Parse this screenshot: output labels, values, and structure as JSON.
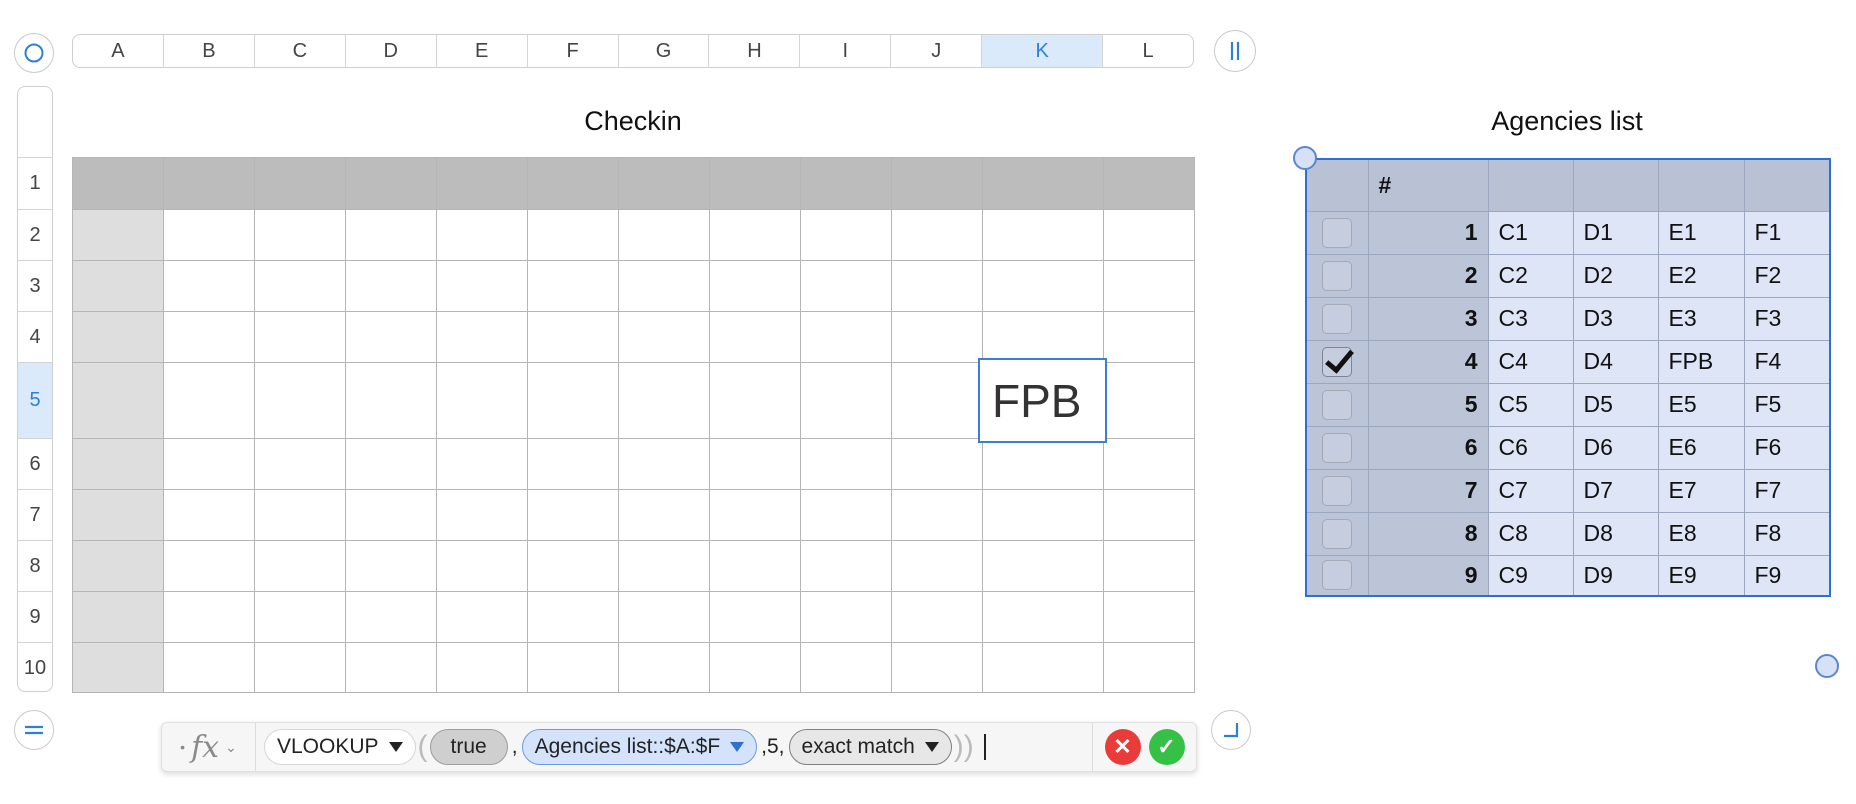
{
  "sheet": {
    "columns": [
      "A",
      "B",
      "C",
      "D",
      "E",
      "F",
      "G",
      "H",
      "I",
      "J",
      "K",
      "L"
    ],
    "selected_column": "K",
    "rows": [
      "1",
      "2",
      "3",
      "4",
      "5",
      "6",
      "7",
      "8",
      "9",
      "10"
    ],
    "selected_row": "5"
  },
  "checkin_table": {
    "title": "Checkin",
    "selected_cell_value": "FPB"
  },
  "agencies_table": {
    "title": "Agencies list",
    "header": [
      "",
      "#",
      "",
      "",
      "",
      ""
    ],
    "rows": [
      {
        "checked": false,
        "num": "1",
        "c": "C1",
        "d": "D1",
        "e": "E1",
        "f": "F1"
      },
      {
        "checked": false,
        "num": "2",
        "c": "C2",
        "d": "D2",
        "e": "E2",
        "f": "F2"
      },
      {
        "checked": false,
        "num": "3",
        "c": "C3",
        "d": "D3",
        "e": "E3",
        "f": "F3"
      },
      {
        "checked": true,
        "num": "4",
        "c": "C4",
        "d": "D4",
        "e": "FPB",
        "f": "F4"
      },
      {
        "checked": false,
        "num": "5",
        "c": "C5",
        "d": "D5",
        "e": "E5",
        "f": "F5"
      },
      {
        "checked": false,
        "num": "6",
        "c": "C6",
        "d": "D6",
        "e": "E6",
        "f": "F6"
      },
      {
        "checked": false,
        "num": "7",
        "c": "C7",
        "d": "D7",
        "e": "E7",
        "f": "F7"
      },
      {
        "checked": false,
        "num": "8",
        "c": "C8",
        "d": "D8",
        "e": "E8",
        "f": "F8"
      },
      {
        "checked": false,
        "num": "9",
        "c": "C9",
        "d": "D9",
        "e": "E9",
        "f": "F9"
      }
    ]
  },
  "formula_bar": {
    "dot": "•",
    "fx_label": "fx",
    "chevron": "⌄",
    "function_name": "VLOOKUP",
    "arg1": "true",
    "separator1": ",",
    "arg2": "Agencies list::$A:$F",
    "separator2_arg3": ",5,",
    "arg4": "exact match",
    "cancel_glyph": "✕",
    "accept_glyph": "✓"
  },
  "colors": {
    "accent": "#2f7fd8",
    "selection_fill": "#dbeafb",
    "agencies_border": "#2f6fd1",
    "cancel": "#ea3b3b",
    "accept": "#35c046"
  },
  "icons": {
    "top_left": "circle-select-icon",
    "top_right": "column-freeze-icon",
    "bottom_left": "row-freeze-icon",
    "bottom_right": "corner-resize-icon"
  }
}
